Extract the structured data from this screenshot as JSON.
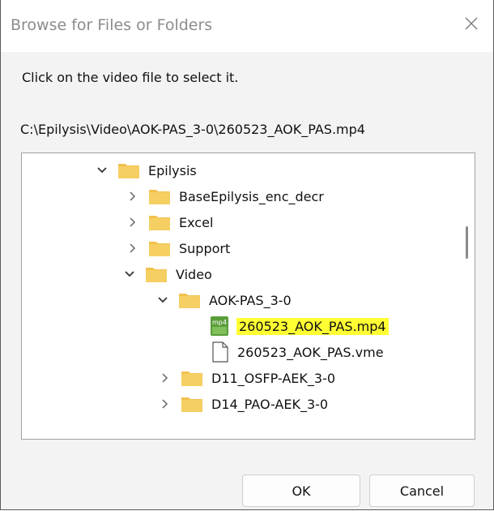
{
  "dialog": {
    "title": "Browse for Files or Folders",
    "instruction": "Click on the video file  to select it.",
    "path": "C:\\Epilysis\\Video\\AOK-PAS_3-0\\260523_AOK_PAS.mp4"
  },
  "tree": {
    "items": [
      {
        "label": "Epilysis",
        "icon": "folder-icon",
        "state": "expanded"
      },
      {
        "label": "BaseEpilysis_enc_decr",
        "icon": "folder-icon",
        "state": "collapsed"
      },
      {
        "label": "Excel",
        "icon": "folder-icon",
        "state": "collapsed"
      },
      {
        "label": "Support",
        "icon": "folder-icon",
        "state": "collapsed"
      },
      {
        "label": "Video",
        "icon": "folder-icon",
        "state": "expanded"
      },
      {
        "label": "AOK-PAS_3-0",
        "icon": "folder-icon",
        "state": "expanded"
      },
      {
        "label": "260523_AOK_PAS.mp4",
        "icon": "mp4-file-icon",
        "state": "leaf",
        "selected": true
      },
      {
        "label": "260523_AOK_PAS.vme",
        "icon": "document-file-icon",
        "state": "leaf"
      },
      {
        "label": "D11_OSFP-AEK_3-0",
        "icon": "folder-icon",
        "state": "collapsed"
      },
      {
        "label": "D14_PAO-AEK_3-0",
        "icon": "folder-icon",
        "state": "collapsed"
      }
    ]
  },
  "buttons": {
    "ok": "OK",
    "cancel": "Cancel"
  },
  "colors": {
    "highlight": "#ffff33",
    "folder": "#f2c14e",
    "mp4_icon": "#5a9e3a"
  }
}
